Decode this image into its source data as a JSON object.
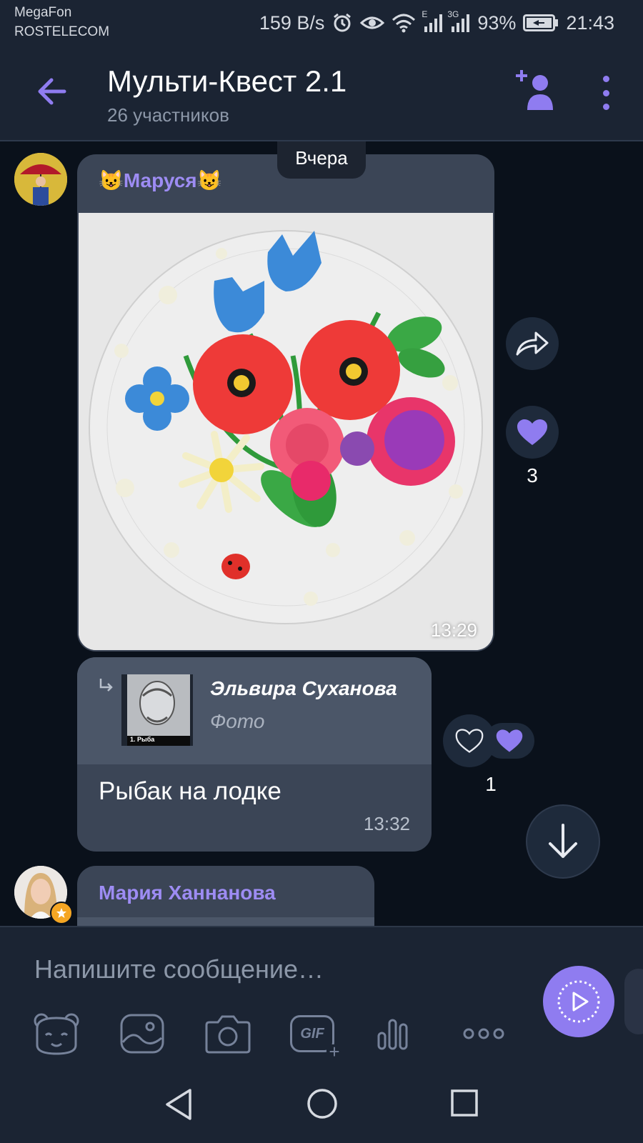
{
  "status_bar": {
    "carrier_1": "MegaFon",
    "carrier_2": "ROSTELECOM",
    "net_speed": "159 B/s",
    "net_type_1": "E",
    "net_type_2": "3G",
    "battery": "93%",
    "time": "21:43"
  },
  "header": {
    "title": "Мульти-Квест 2.1",
    "subtitle": "26 участников"
  },
  "day_separator": "Вчера",
  "messages": [
    {
      "sender": "Маруся",
      "sender_emoji_left": "😺",
      "sender_emoji_right": "😺",
      "time": "13:29",
      "photo_description": "plasticine flowers on glass plate",
      "likes": "3"
    },
    {
      "reply_author": "Эльвира Суханова",
      "reply_type": "Фото",
      "reply_thumb_caption": "1. Рыба",
      "text": "Рыбак на лодке",
      "time": "13:32",
      "likes": "1"
    },
    {
      "sender": "Мария Ханнанова"
    }
  ],
  "composer": {
    "placeholder": "Напишите сообщение…",
    "gif_label": "GIF"
  },
  "colors": {
    "accent": "#8f7cf0",
    "background": "#0a111b",
    "bar": "#1b2433",
    "bubble": "#3b4556"
  }
}
